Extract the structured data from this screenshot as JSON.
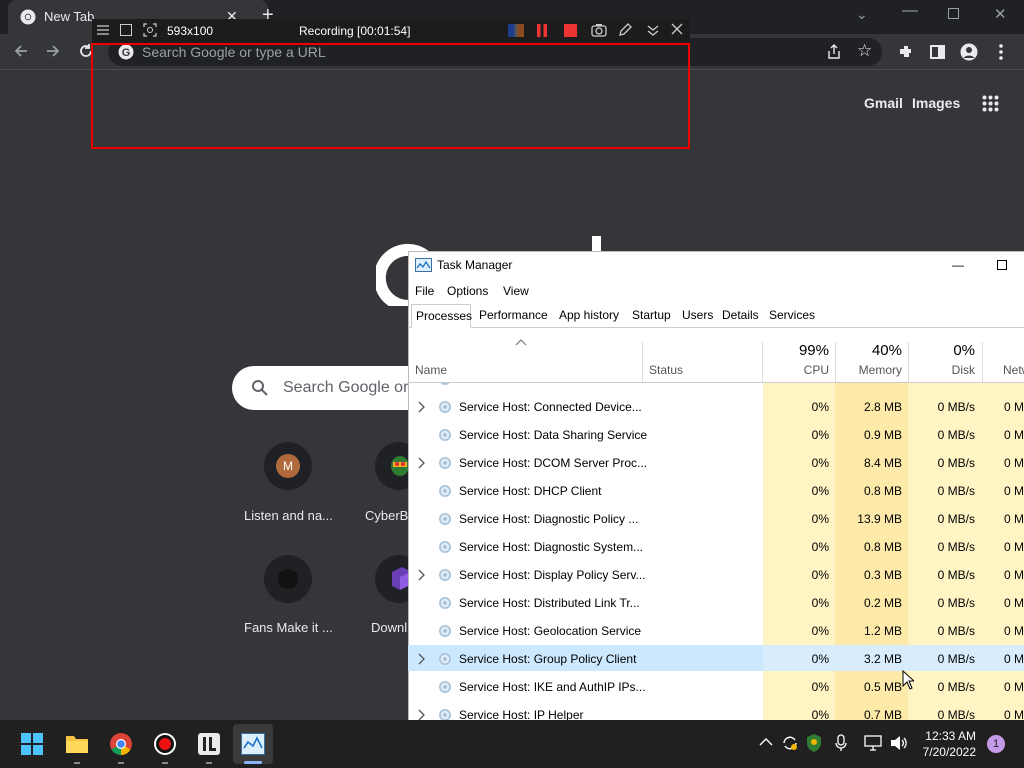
{
  "browser": {
    "tab_title": "New Tab",
    "omnibox_placeholder": "Search Google or type a URL",
    "new_tab_page": {
      "gmail": "Gmail",
      "images": "Images",
      "search_placeholder": "Search Google or",
      "shortcuts": [
        {
          "label": "Listen and na...",
          "initial": "M"
        },
        {
          "label": "CyberB",
          "initial": ""
        },
        {
          "label": "Fans Make it ...",
          "initial": ""
        },
        {
          "label": "Downl",
          "initial": ""
        }
      ]
    }
  },
  "recorder": {
    "size": "593x100",
    "status": "Recording [00:01:54]"
  },
  "task_manager": {
    "title": "Task Manager",
    "menu": [
      "File",
      "Options",
      "View"
    ],
    "tabs": [
      "Processes",
      "Performance",
      "App history",
      "Startup",
      "Users",
      "Details",
      "Services"
    ],
    "active_tab": "Processes",
    "headers": {
      "name": "Name",
      "status": "Status",
      "cpu_pct": "99%",
      "cpu": "CPU",
      "mem_pct": "40%",
      "mem": "Memory",
      "disk_pct": "0%",
      "disk": "Disk",
      "net": "Netw"
    },
    "rows": [
      {
        "name": "Service Host: Connected Device...",
        "cpu": "0%",
        "mem": "2.8 MB",
        "disk": "0 MB/s",
        "net": "0 M",
        "expandable": true
      },
      {
        "name": "Service Host: Data Sharing Service",
        "cpu": "0%",
        "mem": "0.9 MB",
        "disk": "0 MB/s",
        "net": "0 M",
        "expandable": false
      },
      {
        "name": "Service Host: DCOM Server Proc...",
        "cpu": "0%",
        "mem": "8.4 MB",
        "disk": "0 MB/s",
        "net": "0 M",
        "expandable": true
      },
      {
        "name": "Service Host: DHCP Client",
        "cpu": "0%",
        "mem": "0.8 MB",
        "disk": "0 MB/s",
        "net": "0 M",
        "expandable": false
      },
      {
        "name": "Service Host: Diagnostic Policy ...",
        "cpu": "0%",
        "mem": "13.9 MB",
        "disk": "0 MB/s",
        "net": "0 M",
        "expandable": false
      },
      {
        "name": "Service Host: Diagnostic System...",
        "cpu": "0%",
        "mem": "0.8 MB",
        "disk": "0 MB/s",
        "net": "0 M",
        "expandable": false
      },
      {
        "name": "Service Host: Display Policy Serv...",
        "cpu": "0%",
        "mem": "0.3 MB",
        "disk": "0 MB/s",
        "net": "0 M",
        "expandable": true
      },
      {
        "name": "Service Host: Distributed Link Tr...",
        "cpu": "0%",
        "mem": "0.2 MB",
        "disk": "0 MB/s",
        "net": "0 M",
        "expandable": false
      },
      {
        "name": "Service Host: Geolocation Service",
        "cpu": "0%",
        "mem": "1.2 MB",
        "disk": "0 MB/s",
        "net": "0 M",
        "expandable": false
      },
      {
        "name": "Service Host: Group Policy Client",
        "cpu": "0%",
        "mem": "3.2 MB",
        "disk": "0 MB/s",
        "net": "0 M",
        "expandable": true,
        "selected": true
      },
      {
        "name": "Service Host: IKE and AuthIP IPs...",
        "cpu": "0%",
        "mem": "0.5 MB",
        "disk": "0 MB/s",
        "net": "0 M",
        "expandable": false
      },
      {
        "name": "Service Host: IP Helper",
        "cpu": "0%",
        "mem": "0.7 MB",
        "disk": "0 MB/s",
        "net": "0 M",
        "expandable": true
      }
    ]
  },
  "taskbar": {
    "time": "12:33 AM",
    "date": "7/20/2022",
    "notification_count": "1"
  },
  "colors": {
    "chrome_dark": "#202124",
    "chrome_surface": "#35363a",
    "recorder_frame": "#ee0000",
    "cpu_col": "#fff4c4",
    "mem_col": "#fdeaa9",
    "selected_row": "#cce8ff"
  }
}
